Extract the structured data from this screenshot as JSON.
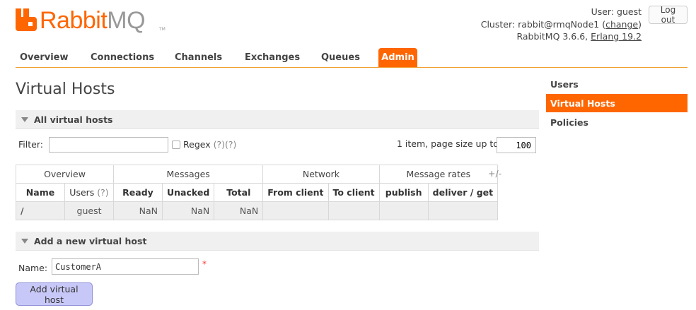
{
  "header": {
    "logo_text_a": "Rabbit",
    "logo_text_b": "MQ",
    "logo_tm": "TM",
    "user_label": "User:",
    "user_name": "guest",
    "cluster_label": "Cluster:",
    "cluster_name": "rabbit@rmqNode1",
    "cluster_change": "change",
    "version_prefix": "RabbitMQ 3.6.6,",
    "erlang_version": "Erlang 19.2",
    "logout_label": "Log out"
  },
  "nav": {
    "tabs": [
      "Overview",
      "Connections",
      "Channels",
      "Exchanges",
      "Queues",
      "Admin"
    ],
    "active": "Admin"
  },
  "sidebar": {
    "items": [
      "Users",
      "Virtual Hosts",
      "Policies"
    ],
    "active": "Virtual Hosts"
  },
  "main": {
    "title": "Virtual Hosts",
    "all_section": "All virtual hosts",
    "filter_label": "Filter:",
    "filter_value": "",
    "regex_label": "Regex",
    "regex_help": "(?)(?)",
    "page_size_text": "1 item, page size up to",
    "page_size_value": "100",
    "table": {
      "groups": [
        "Overview",
        "Messages",
        "Network",
        "Message rates"
      ],
      "columns": [
        "Name",
        "Users",
        "(?)",
        "Ready",
        "Unacked",
        "Total",
        "From client",
        "To client",
        "publish",
        "deliver / get"
      ],
      "rows": [
        {
          "name": "/",
          "users": "guest",
          "ready": "NaN",
          "unacked": "NaN",
          "total": "NaN",
          "from_client": "",
          "to_client": "",
          "publish": "",
          "deliver_get": ""
        }
      ],
      "plus_minus": "+/-"
    },
    "add_section": "Add a new virtual host",
    "name_label": "Name:",
    "name_value": "CustomerA",
    "required_mark": "*",
    "add_button": "Add virtual host"
  },
  "colors": {
    "accent": "#ff6600",
    "button_bg": "#c8c8f8"
  }
}
